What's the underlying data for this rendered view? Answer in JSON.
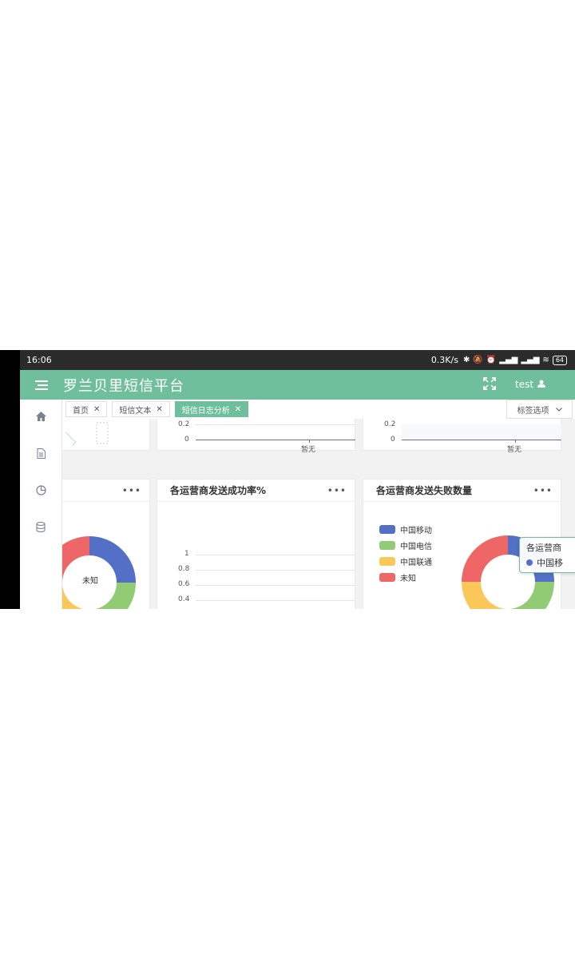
{
  "status_bar": {
    "time": "16:06",
    "speed": "0.3K/s",
    "battery": "64"
  },
  "app": {
    "title": "罗兰贝里短信平台",
    "user": "test"
  },
  "tabs": [
    {
      "label": "首页"
    },
    {
      "label": "短信文本"
    },
    {
      "label": "短信日志分析"
    }
  ],
  "tab_options_label": "标签选项",
  "top_cards": {
    "middle": {
      "ticks": [
        "0.2",
        "0"
      ],
      "empty": "暂无"
    },
    "right": {
      "ticks": [
        "0.2",
        "0"
      ],
      "empty": "暂无"
    }
  },
  "cards": {
    "left": {
      "donut_label": "未知"
    },
    "success_rate": {
      "title": "各运营商发送成功率%",
      "ticks": [
        "1",
        "0.8",
        "0.6",
        "0.4"
      ]
    },
    "failure_count": {
      "title": "各运营商发送失败数量",
      "legend": [
        "中国移动",
        "中国电信",
        "中国联通",
        "未知"
      ],
      "tooltip_title": "各运营商",
      "tooltip_item": "中国移"
    }
  },
  "colors": {
    "brand": "#6fbe9c",
    "mobile": "#5470c6",
    "telecom": "#91cc75",
    "unicom": "#fac858",
    "unknown": "#ee6666"
  },
  "icons": [
    "menu-icon",
    "fullscreen-icon",
    "user-icon",
    "home-icon",
    "document-icon",
    "pie-chart-icon",
    "database-icon",
    "close-icon",
    "chevron-down-icon",
    "more-icon"
  ]
}
